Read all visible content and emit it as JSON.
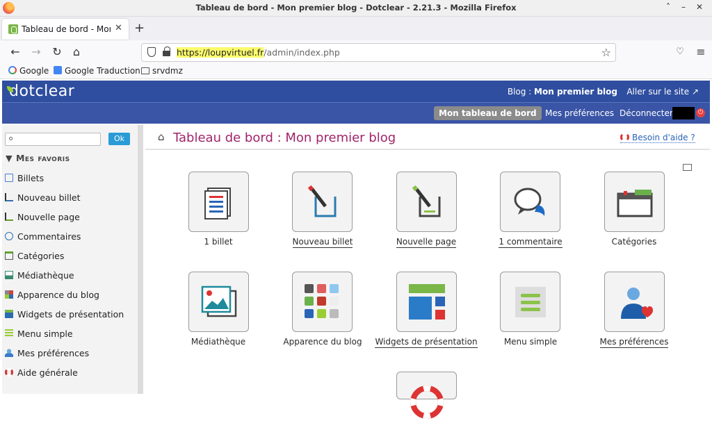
{
  "window": {
    "title": "Tableau de bord - Mon premier blog - Dotclear - 2.21.3 - Mozilla Firefox",
    "controls": [
      "˄",
      "–",
      "✕"
    ]
  },
  "tab": {
    "title": "Tableau de bord - Mon premier blog"
  },
  "urlbar": {
    "url_highlight": "https://loupvirtuel.fr",
    "url_path": "/admin/index.php"
  },
  "bookmarks": [
    {
      "label": "Google"
    },
    {
      "label": "Google Traduction"
    },
    {
      "label": "srvdmz"
    }
  ],
  "header": {
    "logo": "dotclear",
    "blog_prefix": "Blog : ",
    "blog_name": "Mon premier blog",
    "goto_site": "Aller sur le site ↗",
    "my_dashboard": "Mon tableau de bord",
    "my_prefs": "Mes préférences",
    "logout": "Déconnecter"
  },
  "sidebar": {
    "ok": "Ok",
    "favorites_title": "▼ Mes favoris",
    "items": [
      {
        "label": "Billets",
        "color": "#4a7fd0"
      },
      {
        "label": "Nouveau billet",
        "color": "#2f6fae"
      },
      {
        "label": "Nouvelle page",
        "color": "#6a9a2a"
      },
      {
        "label": "Commentaires",
        "color": "#2c6fb5"
      },
      {
        "label": "Catégories",
        "color": "#5ea62d"
      },
      {
        "label": "Médiathèque",
        "color": "#3a8a70"
      },
      {
        "label": "Apparence du blog",
        "color": "#cc4444"
      },
      {
        "label": "Widgets de présentation",
        "color": "#2b6bb0"
      },
      {
        "label": "Menu simple",
        "color": "#9acd32"
      },
      {
        "label": "Mes préférences",
        "color": "#3a7bc8"
      },
      {
        "label": "Aide générale",
        "color": "#cc3333"
      }
    ]
  },
  "main": {
    "title": "Tableau de bord : Mon premier blog",
    "help": "Besoin d'aide ?",
    "tiles": [
      {
        "label": "1 billet",
        "icon": "posts-icon",
        "underline": false
      },
      {
        "label": "Nouveau billet",
        "icon": "new-post-icon",
        "underline": true
      },
      {
        "label": "Nouvelle page",
        "icon": "new-page-icon",
        "underline": true
      },
      {
        "label": "1 commentaire",
        "icon": "comments-icon",
        "underline": true
      },
      {
        "label": "Catégories",
        "icon": "categories-icon",
        "underline": false
      },
      {
        "label": "Médiathèque",
        "icon": "media-icon",
        "underline": false
      },
      {
        "label": "Apparence du blog",
        "icon": "appearance-icon",
        "underline": false
      },
      {
        "label": "Widgets de présentation",
        "icon": "widgets-icon",
        "underline": true
      },
      {
        "label": "Menu simple",
        "icon": "menu-icon",
        "underline": false
      },
      {
        "label": "Mes préférences",
        "icon": "prefs-icon",
        "underline": true
      },
      {
        "label": "",
        "icon": "help-icon",
        "underline": false
      }
    ]
  }
}
